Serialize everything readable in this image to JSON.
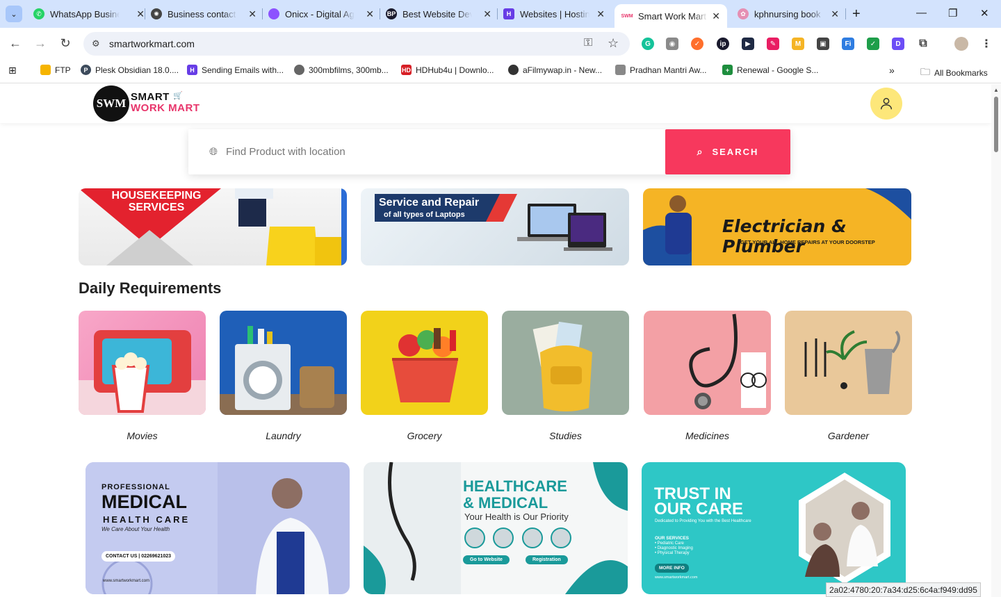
{
  "browser": {
    "tabs": [
      {
        "title": "WhatsApp Business",
        "icon": "whatsapp-icon",
        "color": "#25d366"
      },
      {
        "title": "Business contact info",
        "icon": "openai-icon",
        "color": "#444444"
      },
      {
        "title": "Onicx - Digital Agency",
        "icon": "onicx-icon",
        "color": "#8c52ff"
      },
      {
        "title": "Best Website Developer",
        "icon": "bp-icon",
        "color": "#1a1a2e"
      },
      {
        "title": "Websites | Hostinger",
        "icon": "hostinger-icon",
        "color": "#673de6"
      },
      {
        "title": "Smart Work Mart",
        "icon": "swm-icon",
        "color": "#e8356b"
      },
      {
        "title": "kphnursing book",
        "icon": "kph-icon",
        "color": "#e58fb3"
      }
    ],
    "url": "smartworkmart.com",
    "bookmarks": [
      {
        "label": "FTP",
        "color": "#f6b400"
      },
      {
        "label": "Plesk Obsidian 18.0....",
        "color": "#3d4b5c"
      },
      {
        "label": "Sending Emails with...",
        "color": "#673de6"
      },
      {
        "label": "300mbfilms, 300mb...",
        "color": "#666666"
      },
      {
        "label": "HDHub4u | Downlo...",
        "color": "#d71f26"
      },
      {
        "label": "aFilmywap.in - New...",
        "color": "#333333"
      },
      {
        "label": "Pradhan Mantri Aw...",
        "color": "#888888"
      },
      {
        "label": "Renewal - Google S...",
        "color": "#1e8e3e"
      }
    ],
    "all_bookmarks": "All Bookmarks"
  },
  "site": {
    "logo_abbr": "SWM",
    "logo_line1": "SMART",
    "logo_line2": "WORK MART",
    "search": {
      "placeholder": "Find Product with location",
      "button": "SEARCH"
    },
    "banners": [
      {
        "title": "HOUSEKEEPING SERVICES"
      },
      {
        "title": "Service and Repair",
        "subtitle": "of all types of Laptops"
      },
      {
        "title": "Electrician & Plumber",
        "subtitle": "GET YOUR ALL HOME REPAIRS AT YOUR DOORSTEP"
      }
    ],
    "section_title": "Daily Requirements",
    "categories": [
      {
        "label": "Movies"
      },
      {
        "label": "Laundry"
      },
      {
        "label": "Grocery"
      },
      {
        "label": "Studies"
      },
      {
        "label": "Medicines"
      },
      {
        "label": "Gardener"
      }
    ],
    "promos": [
      {
        "line1": "PROFESSIONAL",
        "line2": "MEDICAL",
        "line3": "HEALTH CARE",
        "line4": "We Care About Your Health",
        "contact": "CONTACT US | 02269621023",
        "url": "www.smartworkmart.com"
      },
      {
        "line1": "HEALTHCARE",
        "line2": "& MEDICAL",
        "line3": "Your Health is Our Priority",
        "btn1": "Go to Website",
        "btn2": "Registration"
      },
      {
        "line1": "TRUST IN",
        "line2": "OUR CARE",
        "line3": "Dedicated to Providing You with the Best Healthcare",
        "services_title": "OUR SERVICES",
        "services": [
          "• Pediatric Care",
          "• Diagnostic Imaging",
          "• Physical Therapy"
        ],
        "more": "MORE INFO",
        "url": "www.smartworkmart.com"
      }
    ]
  },
  "status_tip": "2a02:4780:20:7a34:d25:6c4a:f949:dd95"
}
